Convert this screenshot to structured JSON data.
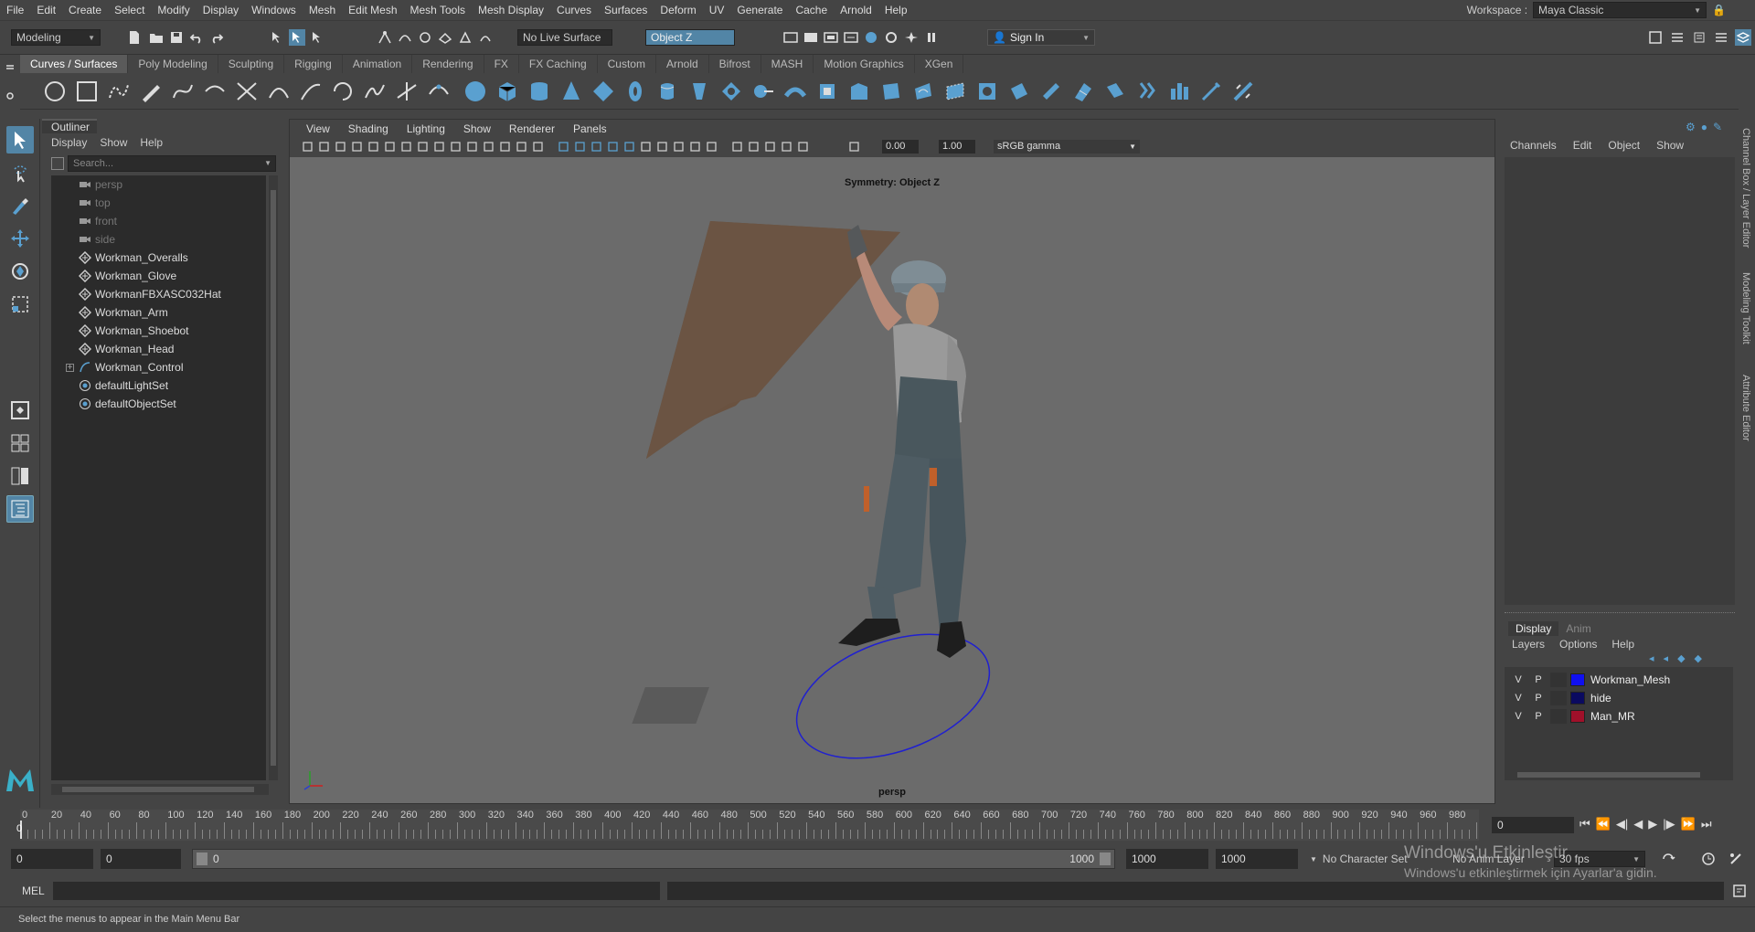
{
  "menubar": {
    "items": [
      "File",
      "Edit",
      "Create",
      "Select",
      "Modify",
      "Display",
      "Windows",
      "Mesh",
      "Edit Mesh",
      "Mesh Tools",
      "Mesh Display",
      "Curves",
      "Surfaces",
      "Deform",
      "UV",
      "Generate",
      "Cache",
      "Arnold",
      "Help"
    ],
    "workspace_label": "Workspace :",
    "workspace_value": "Maya Classic"
  },
  "statusline": {
    "mode": "Modeling",
    "live_surface": "No Live Surface",
    "symmetry": "Object Z",
    "sign_in": "Sign In"
  },
  "shelf": {
    "tabs": [
      "Curves / Surfaces",
      "Poly Modeling",
      "Sculpting",
      "Rigging",
      "Animation",
      "Rendering",
      "FX",
      "FX Caching",
      "Custom",
      "Arnold",
      "Bifrost",
      "MASH",
      "Motion Graphics",
      "XGen"
    ],
    "active_tab": 0,
    "accent": "#5aa0d0"
  },
  "outliner": {
    "title": "Outliner",
    "menu": [
      "Display",
      "Show",
      "Help"
    ],
    "search_placeholder": "Search...",
    "items": [
      {
        "label": "persp",
        "icon": "camera-icon",
        "dim": true
      },
      {
        "label": "top",
        "icon": "camera-icon",
        "dim": true
      },
      {
        "label": "front",
        "icon": "camera-icon",
        "dim": true
      },
      {
        "label": "side",
        "icon": "camera-icon",
        "dim": true
      },
      {
        "label": "Workman_Overalls",
        "icon": "mesh-transform-icon",
        "dim": false
      },
      {
        "label": "Workman_Glove",
        "icon": "mesh-transform-icon",
        "dim": false
      },
      {
        "label": "WorkmanFBXASC032Hat",
        "icon": "mesh-transform-icon",
        "dim": false
      },
      {
        "label": "Workman_Arm",
        "icon": "mesh-transform-icon",
        "dim": false
      },
      {
        "label": "Workman_Shoebot",
        "icon": "mesh-transform-icon",
        "dim": false
      },
      {
        "label": "Workman_Head",
        "icon": "mesh-transform-icon",
        "dim": false
      },
      {
        "label": "Workman_Control",
        "icon": "curve-icon",
        "dim": false,
        "expandable": true
      },
      {
        "label": "defaultLightSet",
        "icon": "set-icon",
        "dim": false
      },
      {
        "label": "defaultObjectSet",
        "icon": "set-icon",
        "dim": false
      }
    ]
  },
  "viewport": {
    "menu": [
      "View",
      "Shading",
      "Lighting",
      "Show",
      "Renderer",
      "Panels"
    ],
    "exposure": "0.00",
    "gamma": "1.00",
    "color_space": "sRGB gamma",
    "hud_symmetry": "Symmetry: Object Z",
    "camera_label": "persp"
  },
  "channelbox": {
    "menu": [
      "Channels",
      "Edit",
      "Object",
      "Show"
    ]
  },
  "layers": {
    "tabs": [
      "Display",
      "Anim"
    ],
    "menu": [
      "Layers",
      "Options",
      "Help"
    ],
    "rows": [
      {
        "v": "V",
        "p": "P",
        "name": "Workman_Mesh",
        "color": "#1010f0"
      },
      {
        "v": "V",
        "p": "P",
        "name": "hide",
        "color": "#0a0a60"
      },
      {
        "v": "V",
        "p": "P",
        "name": "Man_MR",
        "color": "#a0102a"
      }
    ]
  },
  "sidetabs": [
    "Channel Box / Layer Editor",
    "Modeling Toolkit",
    "Attribute Editor"
  ],
  "timeslider": {
    "ticks": [
      "0",
      "20",
      "40",
      "60",
      "80",
      "100",
      "120",
      "140",
      "160",
      "180",
      "200",
      "220",
      "240",
      "260",
      "280",
      "300",
      "320",
      "340",
      "360",
      "380",
      "400",
      "420",
      "440",
      "460",
      "480",
      "500",
      "520",
      "540",
      "560",
      "580",
      "600",
      "620",
      "640",
      "660",
      "680",
      "700",
      "720",
      "740",
      "760",
      "780",
      "800",
      "820",
      "840",
      "860",
      "880",
      "900",
      "920",
      "940",
      "960",
      "980"
    ],
    "current_frame": "0",
    "playhead_label": "0",
    "frame_field": "0"
  },
  "rangeslider": {
    "start": "0",
    "anim_start": "0",
    "slider_start": "0",
    "slider_end": "1000",
    "anim_end": "1000",
    "end": "1000",
    "character_set": "No Character Set",
    "anim_layer": "No Anim Layer",
    "fps": "30 fps"
  },
  "cmdline": {
    "label": "MEL"
  },
  "helpline": {
    "text": "Select the menus to appear in the Main Menu Bar"
  },
  "watermark": {
    "line1": "Windows'u Etkinleştir",
    "line2": "Windows'u etkinleştirmek için Ayarlar'a gidin."
  }
}
